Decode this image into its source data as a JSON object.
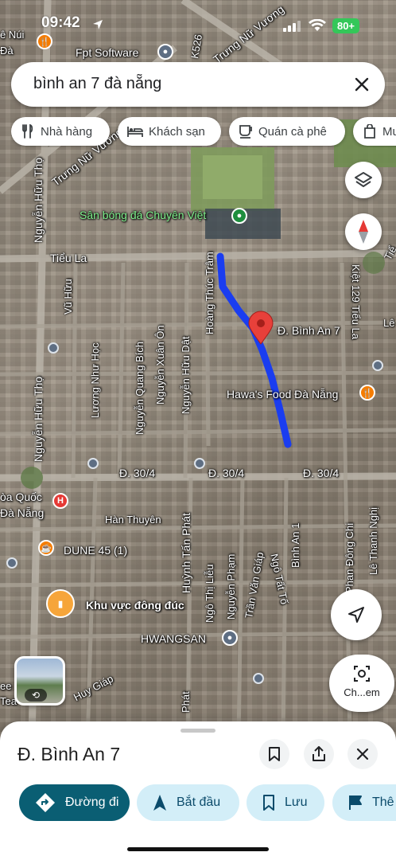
{
  "status_bar": {
    "time": "09:42",
    "battery": "80+"
  },
  "search": {
    "query": "bình an 7 đà nẵng",
    "clear_icon": "close-icon"
  },
  "chips": [
    {
      "label": "Nhà hàng",
      "icon": "restaurant-icon"
    },
    {
      "label": "Khách sạn",
      "icon": "hotel-icon"
    },
    {
      "label": "Quán cà phê",
      "icon": "coffee-icon"
    },
    {
      "label": "Mu",
      "icon": "shopping-icon"
    }
  ],
  "map": {
    "labels": {
      "nui_da": "ê Núi\nĐà",
      "fpt": "Fpt Software",
      "k526": "K526",
      "trung_nu_vuong": "Trưng Nữ Vương",
      "trung_nu_vuong_2": "Trưng Nữ Vương",
      "san_bong": "Sân bóng đá Chuyên Việt",
      "tieu_la": "Tiểu La",
      "tieu_right": "Tiể",
      "vu_huu": "Vũ Hữu",
      "nguyen_huu_tho_top": "Nguyễn Hữu Thọ",
      "nguyen_huu_tho_bottom": "Nguyễn Hữu Thọ",
      "luong_nhu_hoc": "Lương Như Học",
      "nguyen_quang_bich": "Nguyễn Quang Bích",
      "nguyen_xuan_on": "Nguyễn Xuân Ôn",
      "nguyen_huu_dat": "Nguyễn Hữu Dật",
      "hoang_thuc_tram": "Hoàng Thúc Trâm",
      "kiet_129": "Kiệt 129 Tiểu La",
      "le_right": "Lê",
      "binh_an_7": "Đ. Bình An 7",
      "hawas": "Hawa's Food Đà Nẵng",
      "d_30_4_a": "Đ. 30/4",
      "d_30_4_b": "Đ. 30/4",
      "d_30_4_c": "Đ. 30/4",
      "hoa_quoc": "òa Quốc\nĐà Nẵng",
      "han_thuyen": "Hàn Thuyên",
      "dune": "DUNE 45 (1)",
      "khu_vuc": "Khu vực đông đúc",
      "huynh_tan_phat": "Huỳnh Tấn Phát",
      "huynh_tan_phat_2": "Phát",
      "ngo_thi_lieu": "Ngô Thị Liễu",
      "nguyen_pham": "Nguyễn Phạm",
      "tran_van_giap": "Trần Văn Giáp",
      "ngo_tat_to": "Ngô Tất Tố",
      "binh_an_1": "Bình An 1",
      "phan_dong_chi": "Phan Đông Chi",
      "le_thanh_nghi": "Lê Thanh Nghị",
      "hwangsan": "HWANGSAN",
      "huy_giap": "Huy Giáp",
      "tea_left": "ee\nTea"
    }
  },
  "street_view": {
    "badge": "360"
  },
  "lens": {
    "label": "Ch...em"
  },
  "place": {
    "title": "Đ. Bình An 7",
    "actions": [
      {
        "label": "Đường đi",
        "icon": "directions-icon"
      },
      {
        "label": "Bắt đầu",
        "icon": "navigation-arrow-icon"
      },
      {
        "label": "Lưu",
        "icon": "bookmark-icon"
      },
      {
        "label": "Thê",
        "icon": "flag-icon"
      }
    ]
  },
  "colors": {
    "route": "#1a3df0",
    "pin": "#e8403a",
    "primary_action": "#0a5e73",
    "secondary_action": "#d3eef8",
    "battery": "#34c759"
  }
}
